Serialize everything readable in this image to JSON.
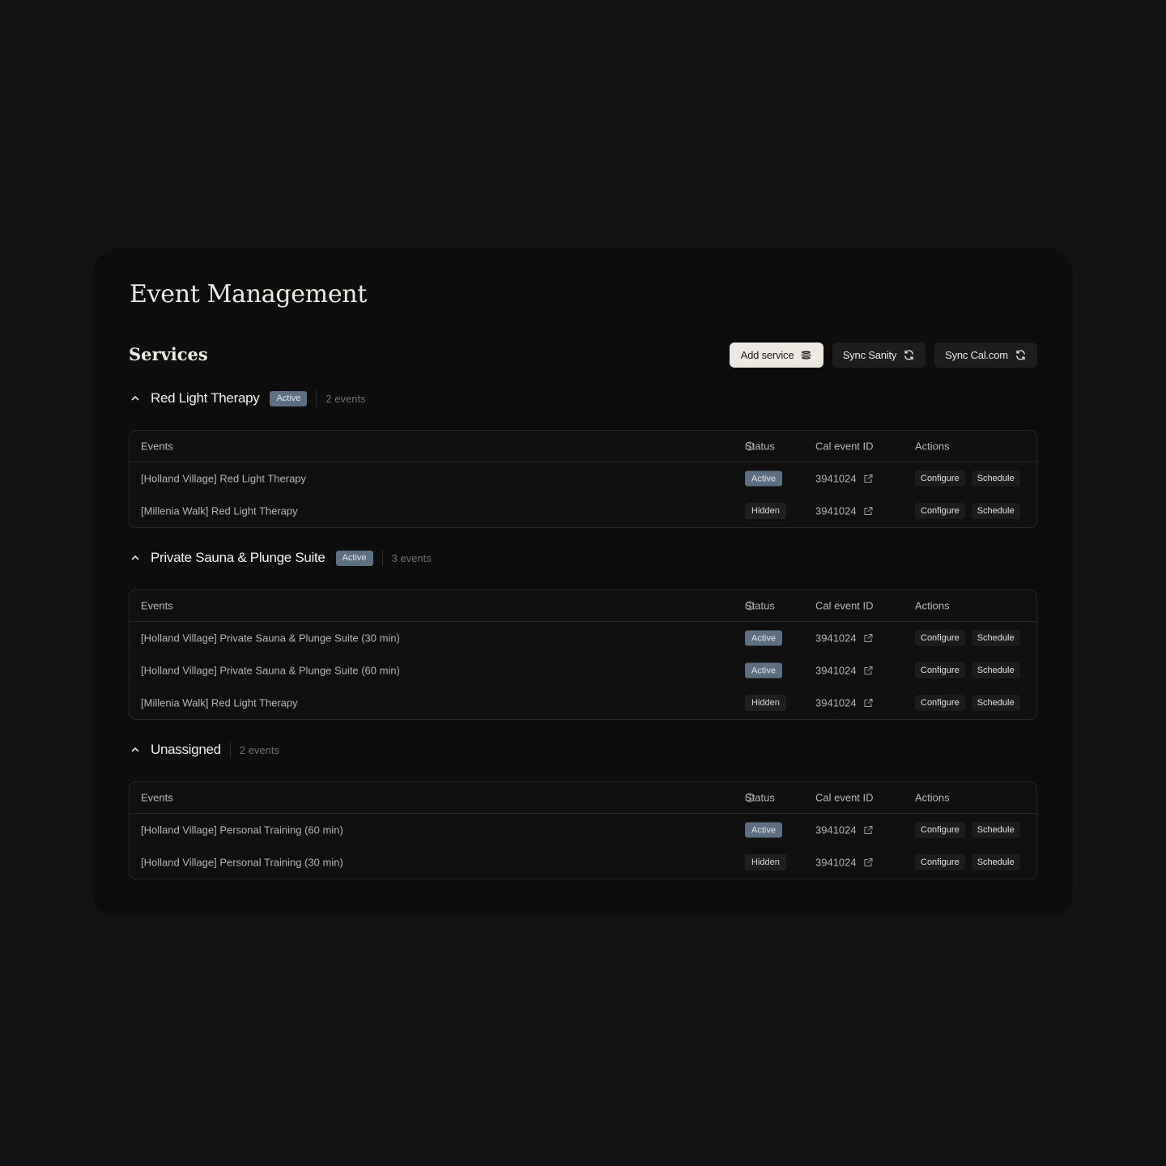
{
  "page": {
    "title": "Event Management",
    "section_title": "Services"
  },
  "toolbar": {
    "add_service": {
      "label": "Add service",
      "icon": "stack-icon"
    },
    "sync_sanity": {
      "label": "Sync Sanity",
      "icon": "refresh-icon"
    },
    "sync_calcom": {
      "label": "Sync Cal.com",
      "icon": "refresh-icon"
    }
  },
  "table_headers": {
    "events": "Events",
    "status": "Status",
    "cal_event_id": "Cal event ID",
    "actions": "Actions"
  },
  "row_actions": {
    "configure": "Configure",
    "schedule": "Schedule"
  },
  "groups": [
    {
      "name": "Red Light Therapy",
      "badge": "Active",
      "count": "2 events",
      "rows": [
        {
          "event": "[Holland Village] Red Light Therapy",
          "status": "Active",
          "cal_id": "3941024"
        },
        {
          "event": "[Millenia Walk] Red Light Therapy",
          "status": "Hidden",
          "cal_id": "3941024"
        }
      ]
    },
    {
      "name": "Private Sauna & Plunge Suite",
      "badge": "Active",
      "count": "3 events",
      "rows": [
        {
          "event": "[Holland Village] Private Sauna & Plunge Suite (30 min)",
          "status": "Active",
          "cal_id": "3941024"
        },
        {
          "event": "[Holland Village] Private Sauna & Plunge Suite (60 min)",
          "status": "Active",
          "cal_id": "3941024"
        },
        {
          "event": "[Millenia Walk] Red Light Therapy",
          "status": "Hidden",
          "cal_id": "3941024"
        }
      ]
    },
    {
      "name": "Unassigned",
      "count": "2 events",
      "rows": [
        {
          "event": "[Holland Village] Personal Training (60 min)",
          "status": "Active",
          "cal_id": "3941024"
        },
        {
          "event": "[Holland Village] Personal Training (30 min)",
          "status": "Hidden",
          "cal_id": "3941024"
        }
      ]
    }
  ],
  "colors": {
    "background": "#121212",
    "panel": "#0d0d0d",
    "active_badge": "#5d6f80",
    "primary_button": "#ebe9e1"
  }
}
